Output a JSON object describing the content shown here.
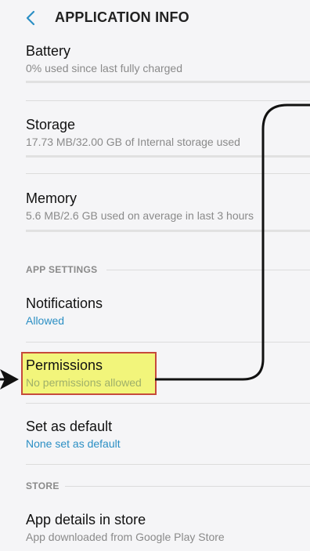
{
  "header": {
    "back_icon": "chevron-left-icon",
    "title": "APPLICATION INFO"
  },
  "items": {
    "battery": {
      "title": "Battery",
      "subtitle": "0% used since last fully charged"
    },
    "storage": {
      "title": "Storage",
      "subtitle": "17.73 MB/32.00 GB of Internal storage used"
    },
    "memory": {
      "title": "Memory",
      "subtitle": "5.6 MB/2.6 GB used on average in last 3 hours"
    },
    "notifications": {
      "title": "Notifications",
      "subtitle": "Allowed"
    },
    "permissions": {
      "title": "Permissions",
      "subtitle": "No permissions allowed"
    },
    "set_default": {
      "title": "Set as default",
      "subtitle": "None set as default"
    },
    "app_details": {
      "title": "App details in store",
      "subtitle": "App downloaded from Google Play Store"
    }
  },
  "sections": {
    "app_settings": "APP SETTINGS",
    "store": "STORE"
  },
  "colors": {
    "accent": "#2b8fc4",
    "highlight_fill": "#f2f57b",
    "highlight_border": "#c64a3c",
    "annotation_line": "#111111"
  }
}
